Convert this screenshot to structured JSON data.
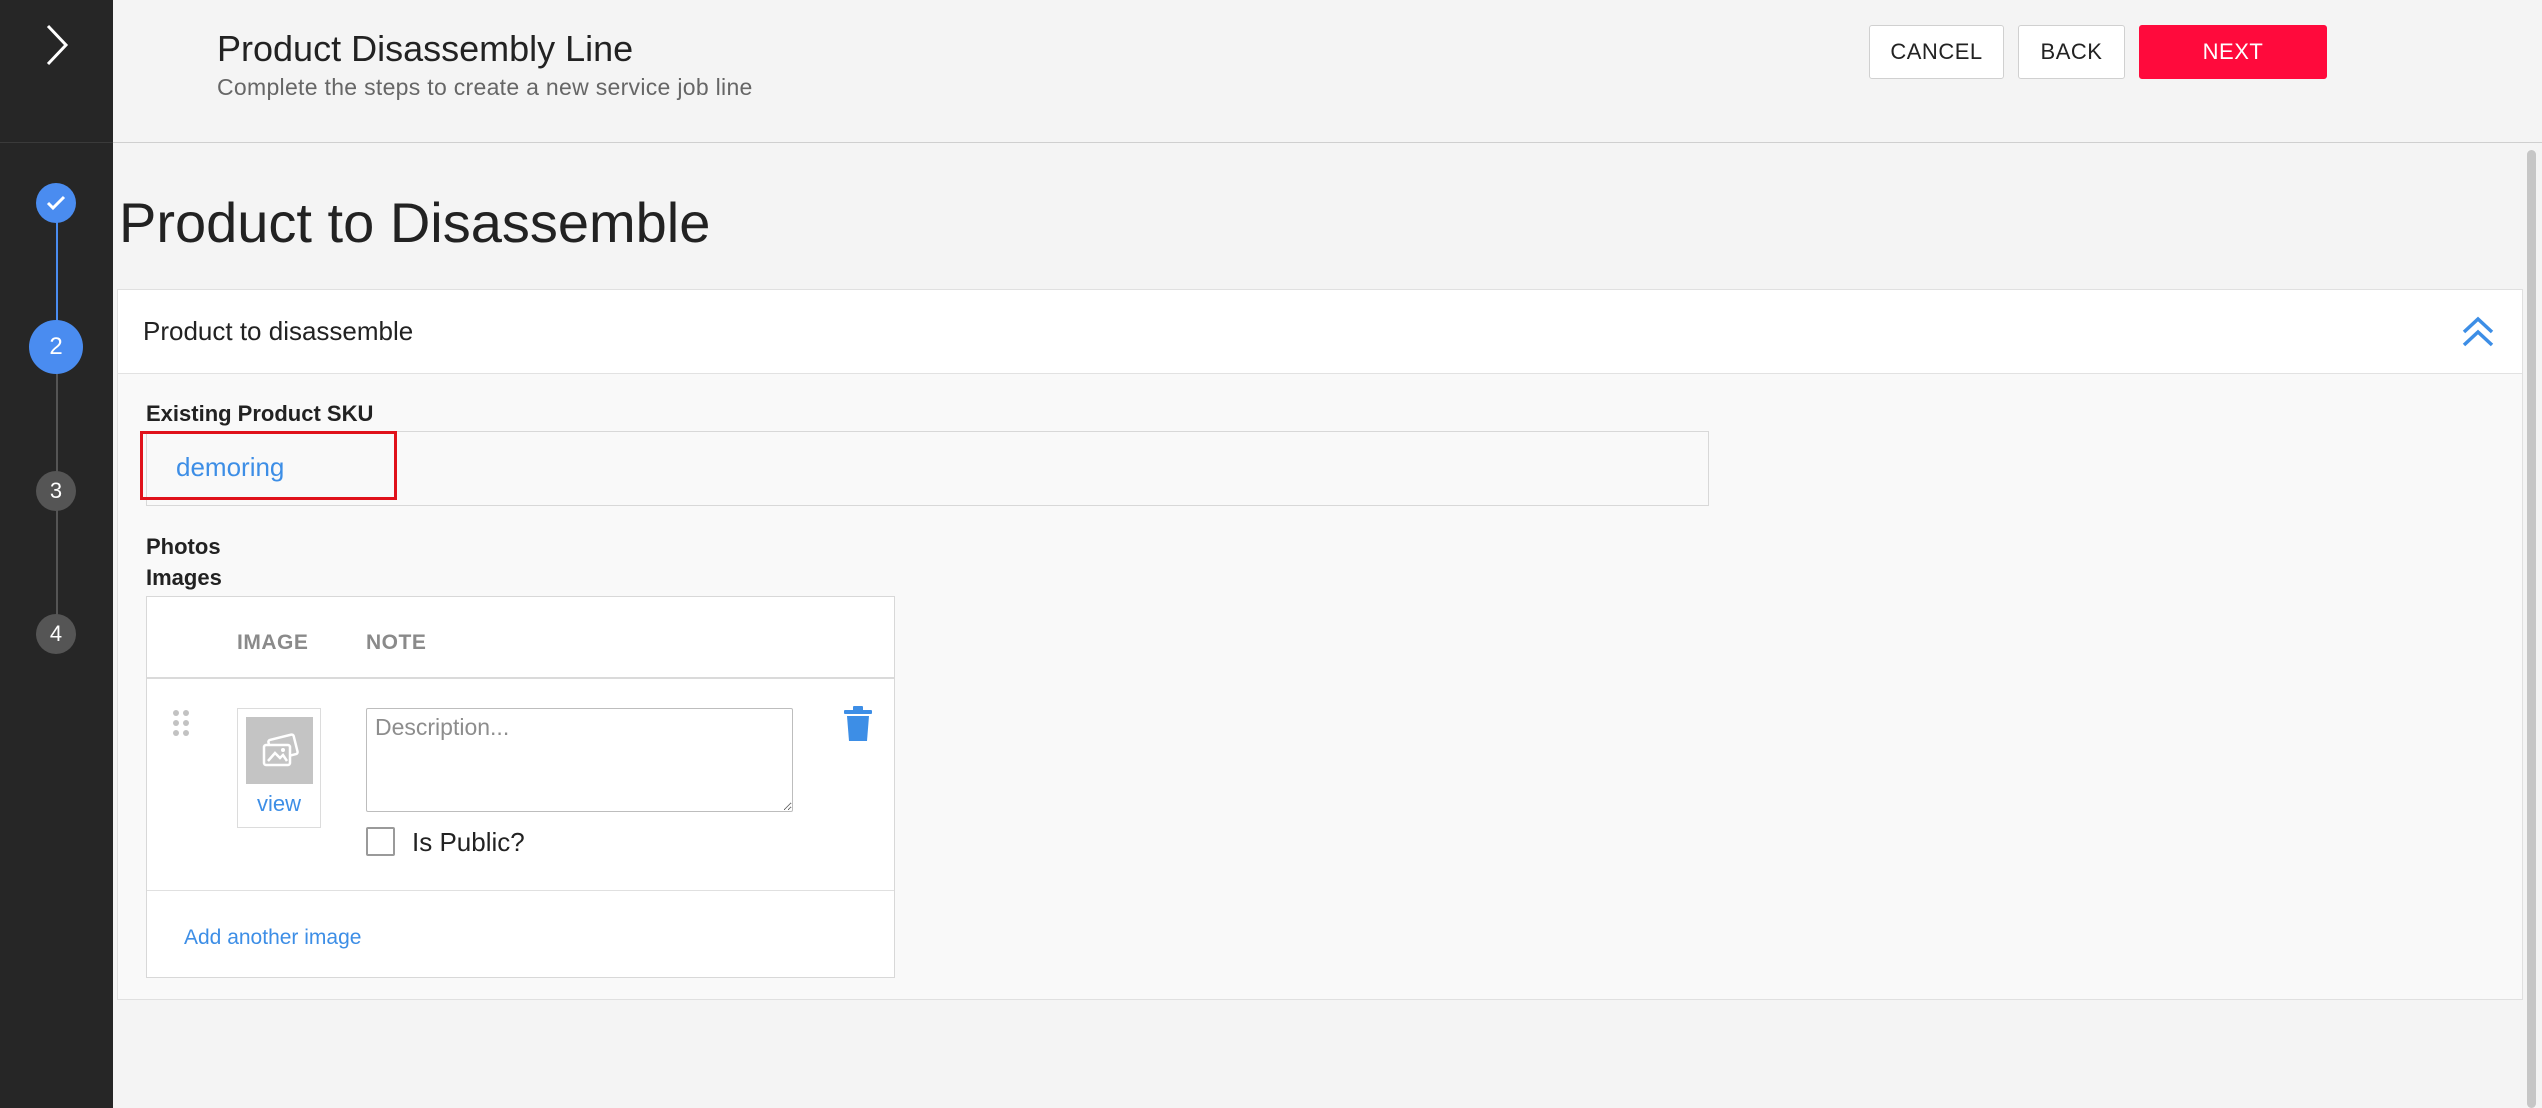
{
  "header": {
    "title": "Product Disassembly Line",
    "subtitle": "Complete the steps to create a new service job line",
    "cancel_label": "CANCEL",
    "back_label": "BACK",
    "next_label": "NEXT"
  },
  "stepper": {
    "steps": [
      {
        "label": "",
        "state": "complete",
        "icon": "check-icon"
      },
      {
        "label": "2",
        "state": "active"
      },
      {
        "label": "3",
        "state": "pending"
      },
      {
        "label": "4",
        "state": "pending"
      }
    ]
  },
  "page": {
    "title": "Product to Disassemble"
  },
  "panel": {
    "title": "Product to disassemble",
    "sku_label": "Existing Product SKU",
    "sku_value": "demoring",
    "photos_label": "Photos",
    "images_label": "Images",
    "table": {
      "col_image": "IMAGE",
      "col_note": "NOTE"
    },
    "image_row": {
      "view_label": "view",
      "note_placeholder": "Description...",
      "note_value": "",
      "is_public_label": "Is Public?",
      "is_public": false
    },
    "add_image_label": "Add another image"
  },
  "colors": {
    "rail_bg": "#262626",
    "accent_blue": "#4a8cf0",
    "link_blue": "#3d8ee6",
    "next_red": "#ff0a3c",
    "highlight_red": "#e0121b"
  }
}
